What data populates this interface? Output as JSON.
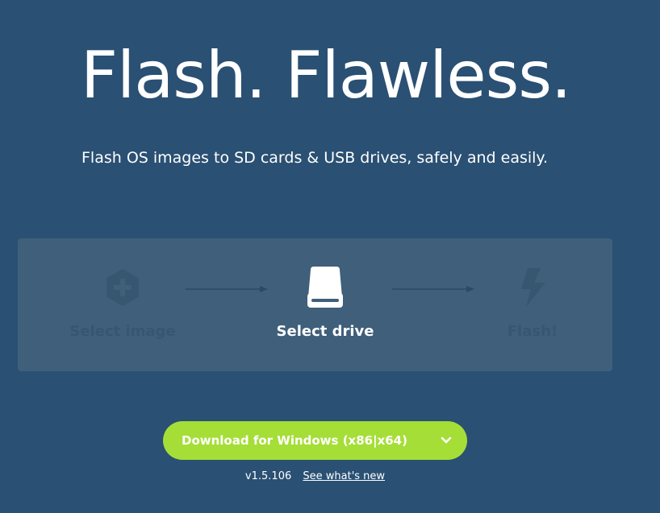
{
  "hero": {
    "headline": "Flash. Flawless.",
    "tagline": "Flash OS images to SD cards & USB drives, safely and easily."
  },
  "steps": {
    "items": [
      {
        "label": "Select image",
        "icon": "add-image-icon",
        "state": "inactive"
      },
      {
        "label": "Select drive",
        "icon": "drive-icon",
        "state": "active"
      },
      {
        "label": "Flash!",
        "icon": "lightning-icon",
        "state": "inactive"
      }
    ]
  },
  "download": {
    "label": "Download for Windows (x86|x64)",
    "icon": "chevron-down-icon"
  },
  "release": {
    "version": "v1.5.106",
    "whats_new_link": "See what's new"
  },
  "colors": {
    "background": "#2a5073",
    "panel": "#3f5f7b",
    "inactive": "#375670",
    "accent": "#a5de37",
    "text": "#ffffff"
  }
}
